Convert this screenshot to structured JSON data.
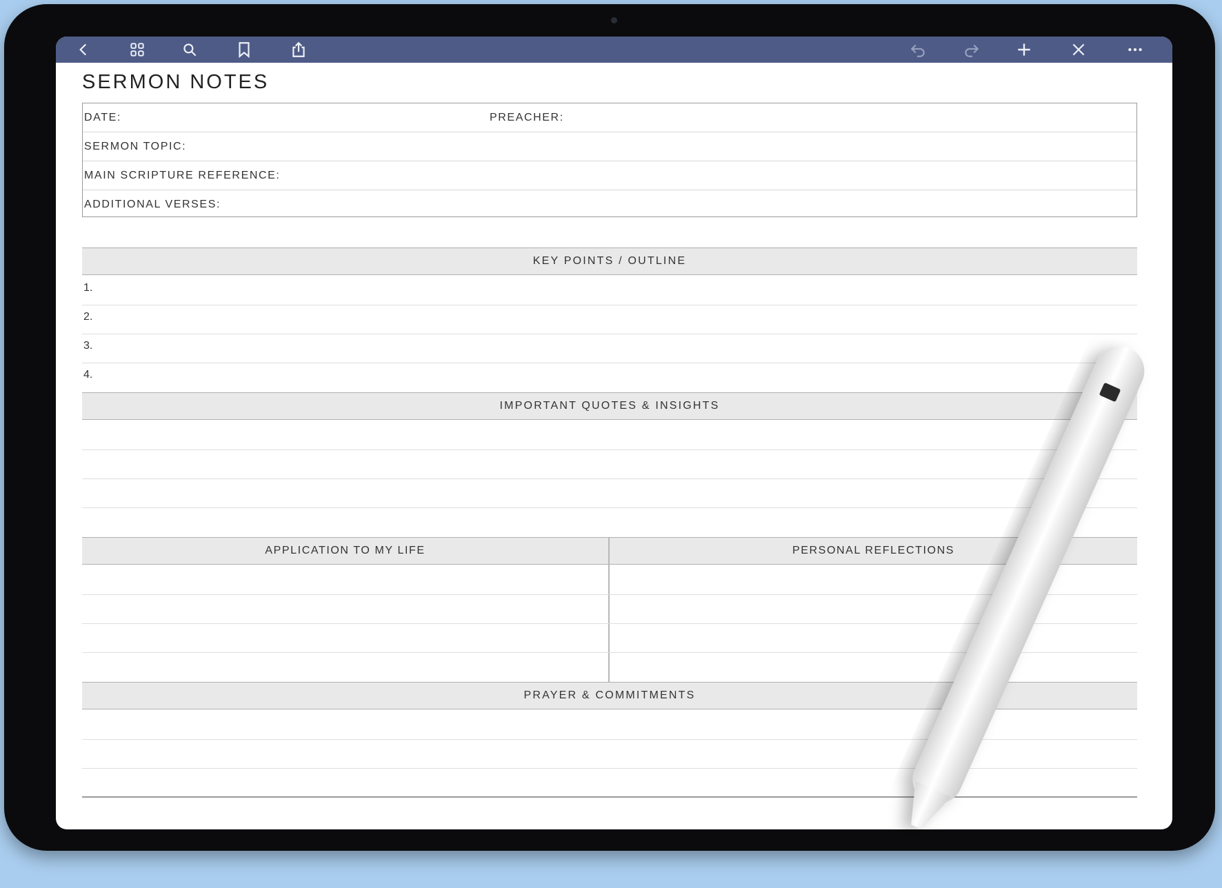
{
  "toolbar": {
    "left_icons": [
      "back-icon",
      "grid-icon",
      "search-icon",
      "bookmark-icon",
      "share-icon"
    ],
    "right_icons": [
      "undo-icon",
      "redo-icon",
      "add-icon",
      "close-icon",
      "more-icon"
    ]
  },
  "document": {
    "title": "SERMON NOTES",
    "fields": {
      "date": "DATE:",
      "preacher": "PREACHER:",
      "topic": "SERMON TOPIC:",
      "scripture": "MAIN SCRIPTURE REFERENCE:",
      "verses": "ADDITIONAL VERSES:"
    },
    "sections": {
      "key_points": "KEY POINTS / OUTLINE",
      "quotes": "IMPORTANT QUOTES & INSIGHTS",
      "application": "APPLICATION TO MY LIFE",
      "reflections": "PERSONAL REFLECTIONS",
      "prayer": "PRAYER & COMMITMENTS"
    },
    "key_point_numbers": [
      "1.",
      "2.",
      "3.",
      "4."
    ]
  },
  "colors": {
    "toolbar": "#4e5b86",
    "header_fill": "#e9e9e9",
    "background": "#a9cdee",
    "device": "#0b0b0d"
  }
}
